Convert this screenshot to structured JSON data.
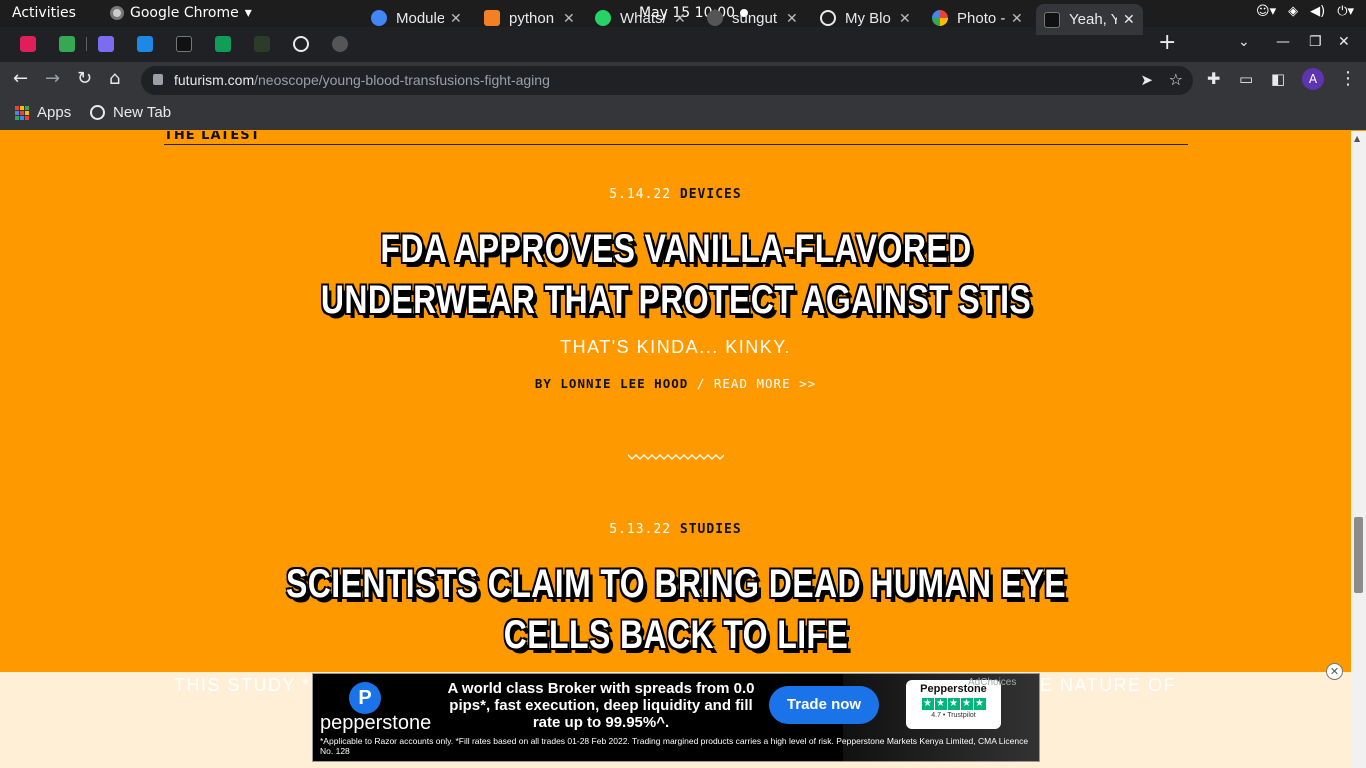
{
  "topbar": {
    "activities": "Activities",
    "app_name": "Google Chrome",
    "clock": "May 15  10:00"
  },
  "tabs": [
    {
      "title": "Module",
      "favicon_color": "#4285f4"
    },
    {
      "title": "python",
      "favicon_color": "#f48024"
    },
    {
      "title": "Whats/",
      "favicon_color": "#25d366"
    },
    {
      "title": "sungut",
      "favicon_color": "#eeeeee"
    },
    {
      "title": "My Blo",
      "favicon_color": "#e8eaed"
    },
    {
      "title": "Photo -",
      "favicon_color": "#fbbc04"
    },
    {
      "title": "Yeah, Y",
      "favicon_color": "#111111",
      "active": true
    }
  ],
  "toolbar": {
    "url_domain": "futurism.com",
    "url_path": "/neoscope/young-blood-transfusions-fight-aging",
    "avatar_letter": "A"
  },
  "bookmarks": [
    {
      "label": "Apps"
    },
    {
      "label": "New Tab"
    }
  ],
  "page": {
    "section_title": "THE LATEST",
    "articles": [
      {
        "date": "5.14.22",
        "category": "DEVICES",
        "headline": "FDA APPROVES VANILLA-FLAVORED UNDERWEAR THAT PROTECT AGAINST STIS",
        "subhead": "THAT'S KINDA... KINKY.",
        "byline": "BY LONNIE LEE HOOD",
        "sep": "/",
        "read_more": "READ MORE >>"
      },
      {
        "date": "5.13.22",
        "category": "STUDIES",
        "headline": "SCIENTISTS CLAIM TO BRING DEAD HUMAN EYE CELLS BACK TO LIFE",
        "subhead_left": "THIS STUDY *",
        "subhead_right": "E NATURE OF"
      }
    ]
  },
  "ad": {
    "brand": "pepperstone",
    "logo_letter": "P",
    "headline": "A world class Broker with spreads from 0.0 pips*, fast execution, deep liquidity and fill rate up to 99.95%^.",
    "cta": "Trade now",
    "trustpilot_name": "Pepperstone",
    "trustpilot_score": "4.7 • Trustpilot",
    "fine_print": "*Applicable to Razor accounts only. *Fill rates based on all trades 01-28 Feb 2022. Trading margined products carries a high level of risk. Pepperstone Markets Kenya Limited, CMA Licence No. 128",
    "adchoices": "AdChoices"
  },
  "colors": {
    "page_bg": "#ff9900",
    "chrome_dark": "#202124",
    "chrome_toolbar": "#35363a",
    "ad_cta": "#1a73e8"
  }
}
